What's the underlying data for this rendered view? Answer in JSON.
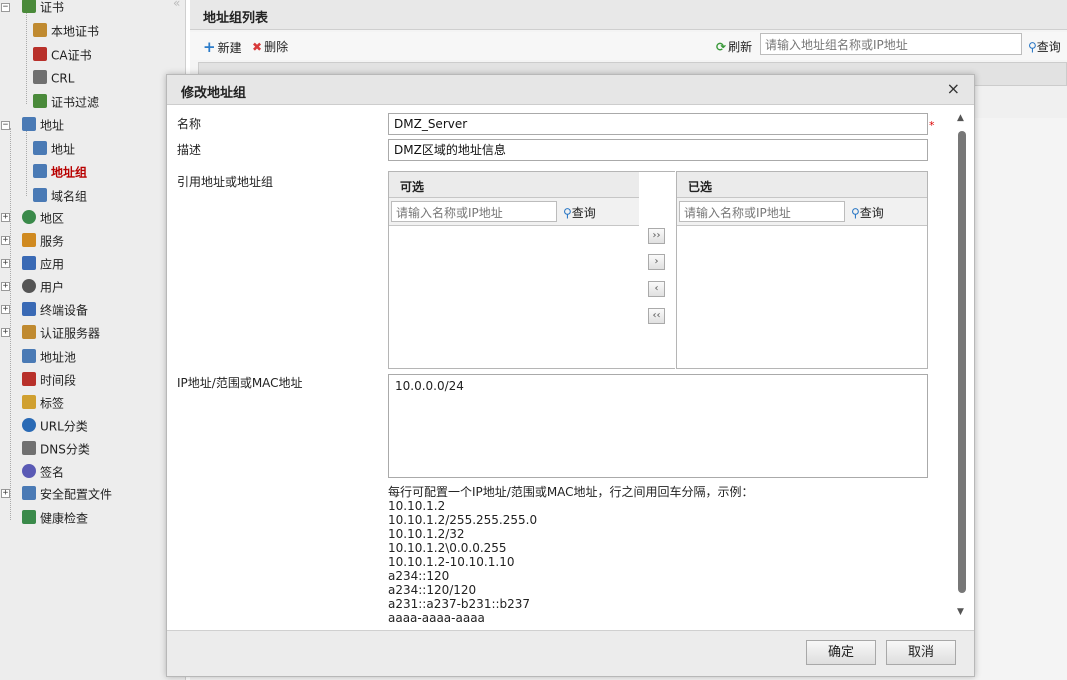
{
  "tree": {
    "items": [
      {
        "label": "证书",
        "icon": "certificate-icon",
        "color": "#4a8a3a"
      },
      {
        "label": "本地证书",
        "icon": "local-certificate-icon",
        "color": "#c08a30"
      },
      {
        "label": "CA证书",
        "icon": "ca-certificate-icon",
        "color": "#b8302a"
      },
      {
        "label": "CRL",
        "icon": "crl-icon",
        "color": "#707070"
      },
      {
        "label": "证书过滤",
        "icon": "certificate-filter-icon",
        "color": "#4a8a3a"
      },
      {
        "label": "地址",
        "icon": "monitor-icon",
        "color": "#4a7ab5"
      },
      {
        "label": "地址",
        "icon": "monitor-icon",
        "color": "#4a7ab5"
      },
      {
        "label": "地址组",
        "icon": "address-group-icon",
        "color": "#4a7ab5"
      },
      {
        "label": "域名组",
        "icon": "domain-group-icon",
        "color": "#4a7ab5"
      },
      {
        "label": "地区",
        "icon": "globe-icon",
        "color": "#3a8a4a"
      },
      {
        "label": "服务",
        "icon": "service-icon",
        "color": "#d08a20"
      },
      {
        "label": "应用",
        "icon": "application-icon",
        "color": "#3a6ab5"
      },
      {
        "label": "用户",
        "icon": "user-icon",
        "color": "#555555"
      },
      {
        "label": "终端设备",
        "icon": "terminal-device-icon",
        "color": "#3a6ab5"
      },
      {
        "label": "认证服务器",
        "icon": "auth-server-icon",
        "color": "#c08a30"
      },
      {
        "label": "地址池",
        "icon": "address-pool-icon",
        "color": "#4a7ab5"
      },
      {
        "label": "时间段",
        "icon": "schedule-icon",
        "color": "#b8302a"
      },
      {
        "label": "标签",
        "icon": "tag-icon",
        "color": "#d0a030"
      },
      {
        "label": "URL分类",
        "icon": "url-category-icon",
        "color": "#2a6ab5"
      },
      {
        "label": "DNS分类",
        "icon": "dns-category-icon",
        "color": "#707070"
      },
      {
        "label": "签名",
        "icon": "signature-icon",
        "color": "#5a5ab5"
      },
      {
        "label": "安全配置文件",
        "icon": "security-profile-icon",
        "color": "#4a7ab5"
      },
      {
        "label": "健康检查",
        "icon": "health-check-icon",
        "color": "#3a8a4a"
      }
    ],
    "collapse_glyph": "«"
  },
  "panel": {
    "title": "地址组列表",
    "add_label": "新建",
    "delete_label": "删除",
    "refresh_label": "刷新",
    "search_placeholder": "请输入地址组名称或IP地址",
    "query_label": "查询"
  },
  "dialog": {
    "title": "修改地址组",
    "close_glyph": "×",
    "name_label": "名称",
    "name_value": "DMZ_Server",
    "desc_label": "描述",
    "desc_value": "DMZ区域的地址信息",
    "ref_label": "引用地址或地址组",
    "available_header": "可选",
    "selected_header": "已选",
    "list_search_placeholder": "请输入名称或IP地址",
    "list_query_label": "查询",
    "move_buttons": [
      "››",
      "›",
      "‹",
      "‹‹"
    ],
    "ip_label": "IP地址/范围或MAC地址",
    "ip_value": "10.0.0.0/24",
    "hint_title": "每行可配置一个IP地址/范围或MAC地址，行之间用回车分隔，示例：",
    "hint_examples": [
      "10.10.1.2",
      "10.10.1.2/255.255.255.0",
      "10.10.1.2/32",
      "10.10.1.2\\0.0.0.255",
      "10.10.1.2-10.10.1.10",
      "a234::120",
      "a234::120/120",
      "a231::a237-b231::b237",
      "aaaa-aaaa-aaaa"
    ],
    "required_mark": "*",
    "ok_label": "确定",
    "cancel_label": "取消"
  },
  "colors": {
    "active_item": "#b80000",
    "accent_blue": "#2b78c5",
    "delete_red": "#d83a3a",
    "refresh_green": "#3b9a3b"
  }
}
